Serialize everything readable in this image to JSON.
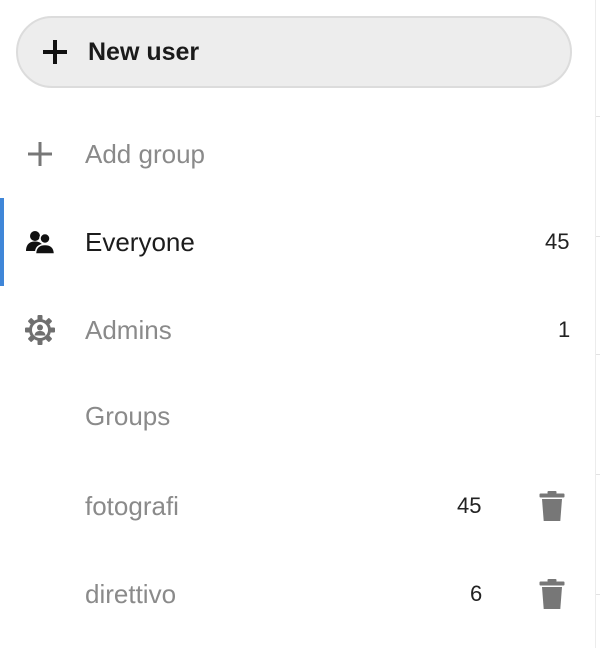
{
  "new_user_button": {
    "label": "New user"
  },
  "add_group": {
    "label": "Add group"
  },
  "nav": {
    "everyone": {
      "label": "Everyone",
      "count": "45"
    },
    "admins": {
      "label": "Admins",
      "count": "1"
    }
  },
  "groups_caption": "Groups",
  "groups": [
    {
      "label": "fotografi",
      "count": "45"
    },
    {
      "label": "direttivo",
      "count": "6"
    }
  ],
  "icons": {
    "new_user": "plus-icon",
    "add_group": "plus-icon",
    "everyone": "users-icon",
    "admins": "shield-gear-icon",
    "group_delete": "trash-icon"
  },
  "colors": {
    "active_accent": "#3f86d8",
    "button_bg": "#ededed",
    "muted_text": "#8a8a8a"
  }
}
